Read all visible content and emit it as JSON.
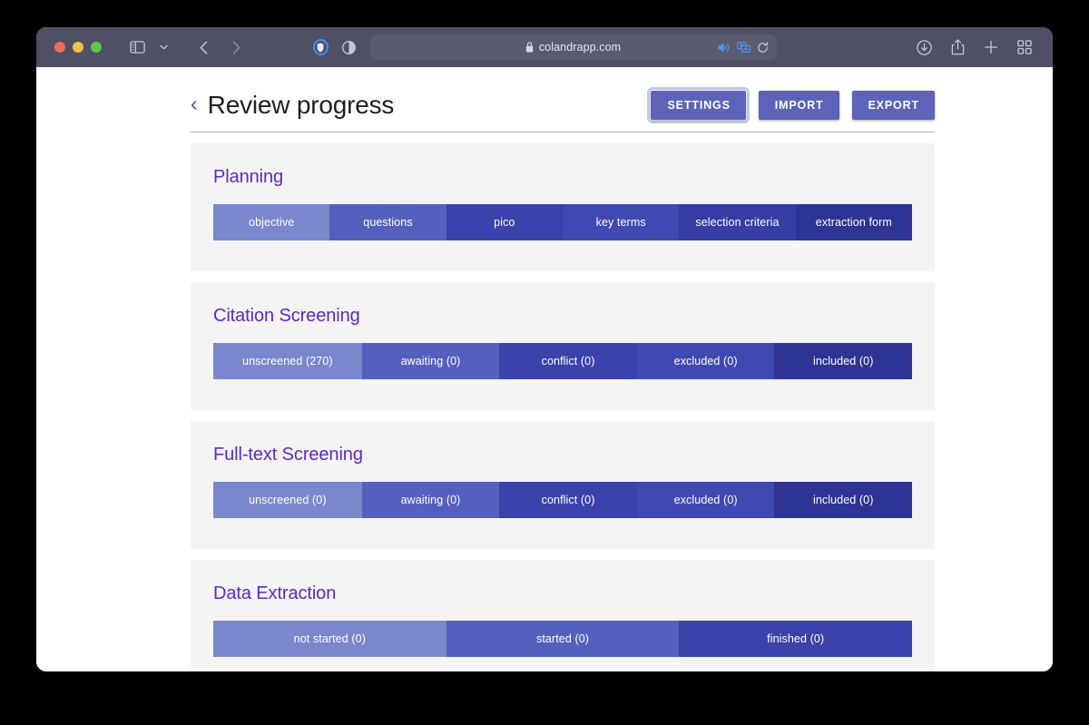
{
  "browser": {
    "url": "colandrapp.com",
    "lock_icon": "lock-icon",
    "traffic_lights": [
      "close",
      "minimize",
      "maximize"
    ],
    "toolbar_icons": {
      "sidebar": "sidebar-icon",
      "sidebar_caret": "chevron-down-icon",
      "back": "back-arrow-icon",
      "forward": "forward-arrow-icon",
      "shield": "privacy-shield-icon",
      "reader": "reader-view-icon",
      "mute": "speaker-mute-icon",
      "translate": "translate-icon",
      "reload": "reload-icon",
      "downloads": "download-icon",
      "share": "share-icon",
      "new_tab": "plus-icon",
      "tab_overview": "tab-overview-icon"
    },
    "nav_back_glyph": "‹",
    "nav_forward_glyph": "›",
    "caret_glyph": "⌄"
  },
  "header": {
    "back_glyph": "‹",
    "title": "Review progress",
    "buttons": [
      {
        "label": "SETTINGS",
        "focused": true
      },
      {
        "label": "IMPORT",
        "focused": false
      },
      {
        "label": "EXPORT",
        "focused": false
      }
    ]
  },
  "colors": {
    "accent_purple": "#5a28c8",
    "button_blue": "#5c63b8",
    "card_bg": "#f4f4f5",
    "page_bg": "#ffffff",
    "titlebar_bg": "#4f5063",
    "shade_1": "#7b87cc",
    "shade_2": "#5560be",
    "shade_3": "#3b42ab",
    "shade_4": "#4048b2",
    "shade_5": "#363da4",
    "shade_6": "#2e3493"
  },
  "sections": [
    {
      "title": "Planning",
      "segments": [
        {
          "label": "objective",
          "color": "#7b87cc",
          "flex": 1
        },
        {
          "label": "questions",
          "color": "#5560be",
          "flex": 1
        },
        {
          "label": "pico",
          "color": "#3b42ab",
          "flex": 1
        },
        {
          "label": "key terms",
          "color": "#4048b2",
          "flex": 1
        },
        {
          "label": "selection criteria",
          "color": "#363da4",
          "flex": 1
        },
        {
          "label": "extraction form",
          "color": "#2e3493",
          "flex": 1
        }
      ]
    },
    {
      "title": "Citation Screening",
      "segments": [
        {
          "label": "unscreened (270)",
          "color": "#7b87cc",
          "flex": 1.08
        },
        {
          "label": "awaiting (0)",
          "color": "#5560be",
          "flex": 1.0
        },
        {
          "label": "conflict (0)",
          "color": "#3b42ab",
          "flex": 1.0
        },
        {
          "label": "excluded (0)",
          "color": "#4048b2",
          "flex": 1.0
        },
        {
          "label": "included (0)",
          "color": "#2e3493",
          "flex": 1.0
        }
      ]
    },
    {
      "title": "Full-text Screening",
      "segments": [
        {
          "label": "unscreened (0)",
          "color": "#7b87cc",
          "flex": 1.08
        },
        {
          "label": "awaiting (0)",
          "color": "#5560be",
          "flex": 1.0
        },
        {
          "label": "conflict (0)",
          "color": "#3b42ab",
          "flex": 1.0
        },
        {
          "label": "excluded (0)",
          "color": "#4048b2",
          "flex": 1.0
        },
        {
          "label": "included (0)",
          "color": "#2e3493",
          "flex": 1.0
        }
      ]
    },
    {
      "title": "Data Extraction",
      "segments": [
        {
          "label": "not started (0)",
          "color": "#7b87cc",
          "flex": 1
        },
        {
          "label": "started (0)",
          "color": "#5560be",
          "flex": 1
        },
        {
          "label": "finished (0)",
          "color": "#3b42ab",
          "flex": 1
        }
      ]
    }
  ]
}
